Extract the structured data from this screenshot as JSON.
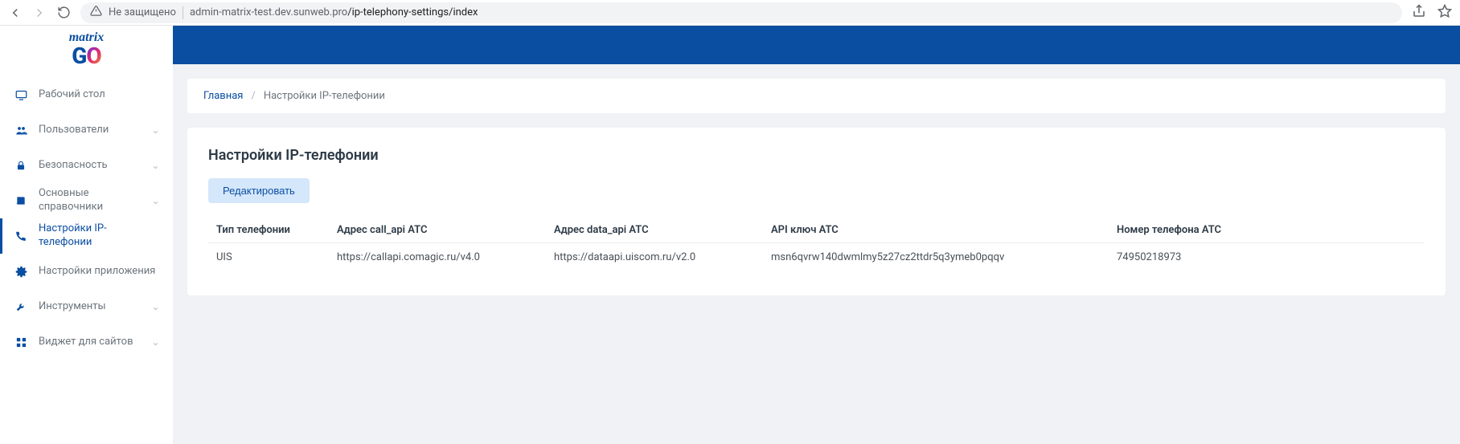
{
  "browser": {
    "not_secure": "Не защищено",
    "url_host": "admin-matrix-test.dev.sunweb.pro",
    "url_path": "/ip-telephony-settings/index"
  },
  "logo": {
    "top": "matrix",
    "g": "G",
    "o": "O"
  },
  "sidebar": {
    "items": [
      {
        "label": "Рабочий стол",
        "expandable": false
      },
      {
        "label": "Пользователи",
        "expandable": true
      },
      {
        "label": "Безопасность",
        "expandable": true
      },
      {
        "label": "Основные справочники",
        "expandable": true
      },
      {
        "label": "Настройки IP-телефонии",
        "expandable": false
      },
      {
        "label": "Настройки приложения",
        "expandable": false
      },
      {
        "label": "Инструменты",
        "expandable": true
      },
      {
        "label": "Виджет для сайтов",
        "expandable": true
      }
    ]
  },
  "breadcrumb": {
    "home": "Главная",
    "current": "Настройки IP-телефонии"
  },
  "panel": {
    "title": "Настройки IP-телефонии",
    "edit": "Редактировать"
  },
  "table": {
    "headers": {
      "type": "Тип телефонии",
      "call_api": "Адрес call_api АТС",
      "data_api": "Адрес data_api АТС",
      "api_key": "API ключ АТС",
      "phone": "Номер телефона АТС"
    },
    "row": {
      "type": "UIS",
      "call_api": "https://callapi.comagic.ru/v4.0",
      "data_api": "https://dataapi.uiscom.ru/v2.0",
      "api_key": "msn6qvrw140dwmlmy5z27cz2ttdr5q3ymeb0pqqv",
      "phone": "74950218973"
    }
  }
}
